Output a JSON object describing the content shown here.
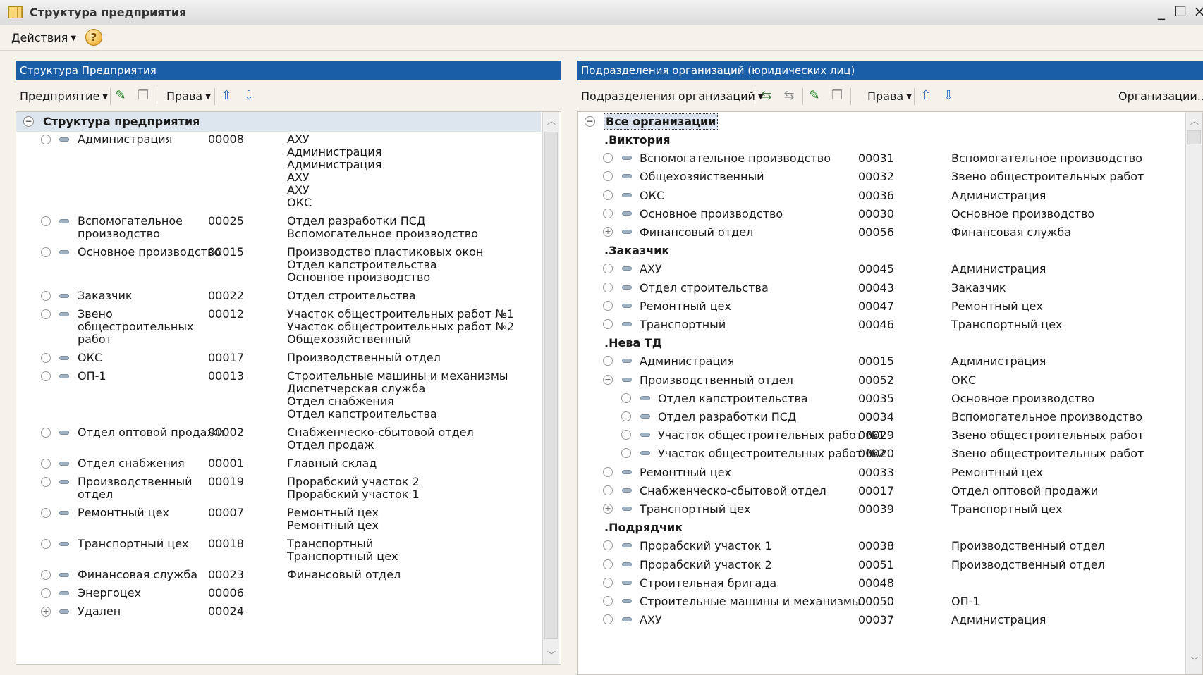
{
  "window": {
    "title": "Структура предприятия",
    "minimize": "_",
    "maximize": "☐",
    "close": "×"
  },
  "menu": {
    "actions": "Действия",
    "help": "?"
  },
  "left": {
    "header": "Структура Предприятия",
    "toolbar": {
      "enterprise": "Предприятие",
      "rights": "Права"
    },
    "root": "Структура предприятия",
    "rows": [
      {
        "name": "Администрация",
        "code": "00008",
        "links": "АХУ\nАдминистрация\nАдминистрация\nАХУ\nАХУ\nОКС",
        "expand": false
      },
      {
        "name": "Вспомогательное\nпроизводство",
        "code": "00025",
        "links": "Отдел разработки ПСД\nВспомогательное производство",
        "expand": false
      },
      {
        "name": "Основное производство",
        "code": "00015",
        "links": "Производство пластиковых окон\nОтдел капстроительства\nОсновное производство",
        "expand": false
      },
      {
        "name": "Заказчик",
        "code": "00022",
        "links": "Отдел  строительства",
        "expand": false
      },
      {
        "name": "Звено\nобщестроительных\nработ",
        "code": "00012",
        "links": "Участок общестроительных работ №1\nУчасток общестроительных работ №2\nОбщехозяйственный",
        "expand": false
      },
      {
        "name": "ОКС",
        "code": "00017",
        "links": "Производственный отдел",
        "expand": false
      },
      {
        "name": "ОП-1",
        "code": "00013",
        "links": "Строительные машины и механизмы\nДиспетчерская служба\nОтдел снабжения\nОтдел капстроительства",
        "expand": false
      },
      {
        "name": "Отдел оптовой продажи",
        "code": "00002",
        "links": "Снабженческо-сбытовой отдел\nОтдел продаж",
        "expand": false
      },
      {
        "name": "Отдел снабжения",
        "code": "00001",
        "links": "Главный склад",
        "expand": false
      },
      {
        "name": "Производственный\nотдел",
        "code": "00019",
        "links": "Прорабский участок 2\nПрорабский участок 1",
        "expand": false
      },
      {
        "name": "Ремонтный цех",
        "code": "00007",
        "links": "Ремонтный цех\nРемонтный цех",
        "expand": false
      },
      {
        "name": "Транспортный цех",
        "code": "00018",
        "links": "Транспортный\nТранспортный цех",
        "expand": false
      },
      {
        "name": "Финансовая служба",
        "code": "00023",
        "links": "Финансовый отдел",
        "expand": false
      },
      {
        "name": "Энергоцех",
        "code": "00006",
        "links": "",
        "expand": false
      },
      {
        "name": "Удален",
        "code": "00024",
        "links": "",
        "expand": true
      }
    ]
  },
  "right": {
    "header": "Подразделения организаций (юридических лиц)",
    "toolbar": {
      "subdivisions": "Подразделения организаций",
      "rights": "Права",
      "organizations": "Организации..."
    },
    "root": "Все организации",
    "groups": [
      {
        "label": ".Виктория",
        "rows": [
          {
            "name": "Вспомогательное производство",
            "code": "00031",
            "unit": "Вспомогательное производство",
            "level": 0,
            "mark": ""
          },
          {
            "name": "Общехозяйственный",
            "code": "00032",
            "unit": "Звено общестроительных работ",
            "level": 0,
            "mark": ""
          },
          {
            "name": "ОКС",
            "code": "00036",
            "unit": "Администрация",
            "level": 0,
            "mark": ""
          },
          {
            "name": "Основное производство",
            "code": "00030",
            "unit": "Основное производство",
            "level": 0,
            "mark": ""
          },
          {
            "name": "Финансовый отдел",
            "code": "00056",
            "unit": "Финансовая служба",
            "level": 0,
            "mark": "+"
          }
        ]
      },
      {
        "label": ".Заказчик",
        "rows": [
          {
            "name": "АХУ",
            "code": "00045",
            "unit": "Администрация",
            "level": 0,
            "mark": ""
          },
          {
            "name": "Отдел  строительства",
            "code": "00043",
            "unit": "Заказчик",
            "level": 0,
            "mark": ""
          },
          {
            "name": "Ремонтный цех",
            "code": "00047",
            "unit": "Ремонтный цех",
            "level": 0,
            "mark": ""
          },
          {
            "name": "Транспортный",
            "code": "00046",
            "unit": "Транспортный цех",
            "level": 0,
            "mark": ""
          }
        ]
      },
      {
        "label": ".Нева ТД",
        "rows": [
          {
            "name": "Администрация",
            "code": "00015",
            "unit": "Администрация",
            "level": 0,
            "mark": ""
          },
          {
            "name": "Производственный отдел",
            "code": "00052",
            "unit": "ОКС",
            "level": 0,
            "mark": "−"
          },
          {
            "name": "Отдел капстроительства",
            "code": "00035",
            "unit": "Основное производство",
            "level": 1,
            "mark": ""
          },
          {
            "name": "Отдел разработки ПСД",
            "code": "00034",
            "unit": "Вспомогательное производство",
            "level": 1,
            "mark": ""
          },
          {
            "name": "Участок общестроительных работ №1",
            "code": "00029",
            "unit": "Звено общестроительных работ",
            "level": 1,
            "mark": ""
          },
          {
            "name": "Участок общестроительных работ №2",
            "code": "00020",
            "unit": "Звено общестроительных работ",
            "level": 1,
            "mark": ""
          },
          {
            "name": "Ремонтный цех",
            "code": "00033",
            "unit": "Ремонтный цех",
            "level": 0,
            "mark": ""
          },
          {
            "name": "Снабженческо-сбытовой отдел",
            "code": "00017",
            "unit": "Отдел оптовой продажи",
            "level": 0,
            "mark": ""
          },
          {
            "name": "Транспортный цех",
            "code": "00039",
            "unit": "Транспортный цех",
            "level": 0,
            "mark": "+"
          }
        ]
      },
      {
        "label": ".Подрядчик",
        "rows": [
          {
            "name": "Прорабский участок 1",
            "code": "00038",
            "unit": "Производственный отдел",
            "level": 0,
            "mark": ""
          },
          {
            "name": "Прорабский участок 2",
            "code": "00051",
            "unit": "Производственный отдел",
            "level": 0,
            "mark": ""
          },
          {
            "name": "Строительная бригада",
            "code": "00048",
            "unit": "",
            "level": 0,
            "mark": ""
          },
          {
            "name": "Строительные машины и механизмы",
            "code": "00050",
            "unit": "ОП-1",
            "level": 0,
            "mark": ""
          },
          {
            "name": "АХУ",
            "code": "00037",
            "unit": "Администрация",
            "level": 0,
            "mark": ""
          }
        ]
      }
    ]
  },
  "colors": {
    "panel_header": "#1a5ea8",
    "selection": "#dde5ee"
  }
}
